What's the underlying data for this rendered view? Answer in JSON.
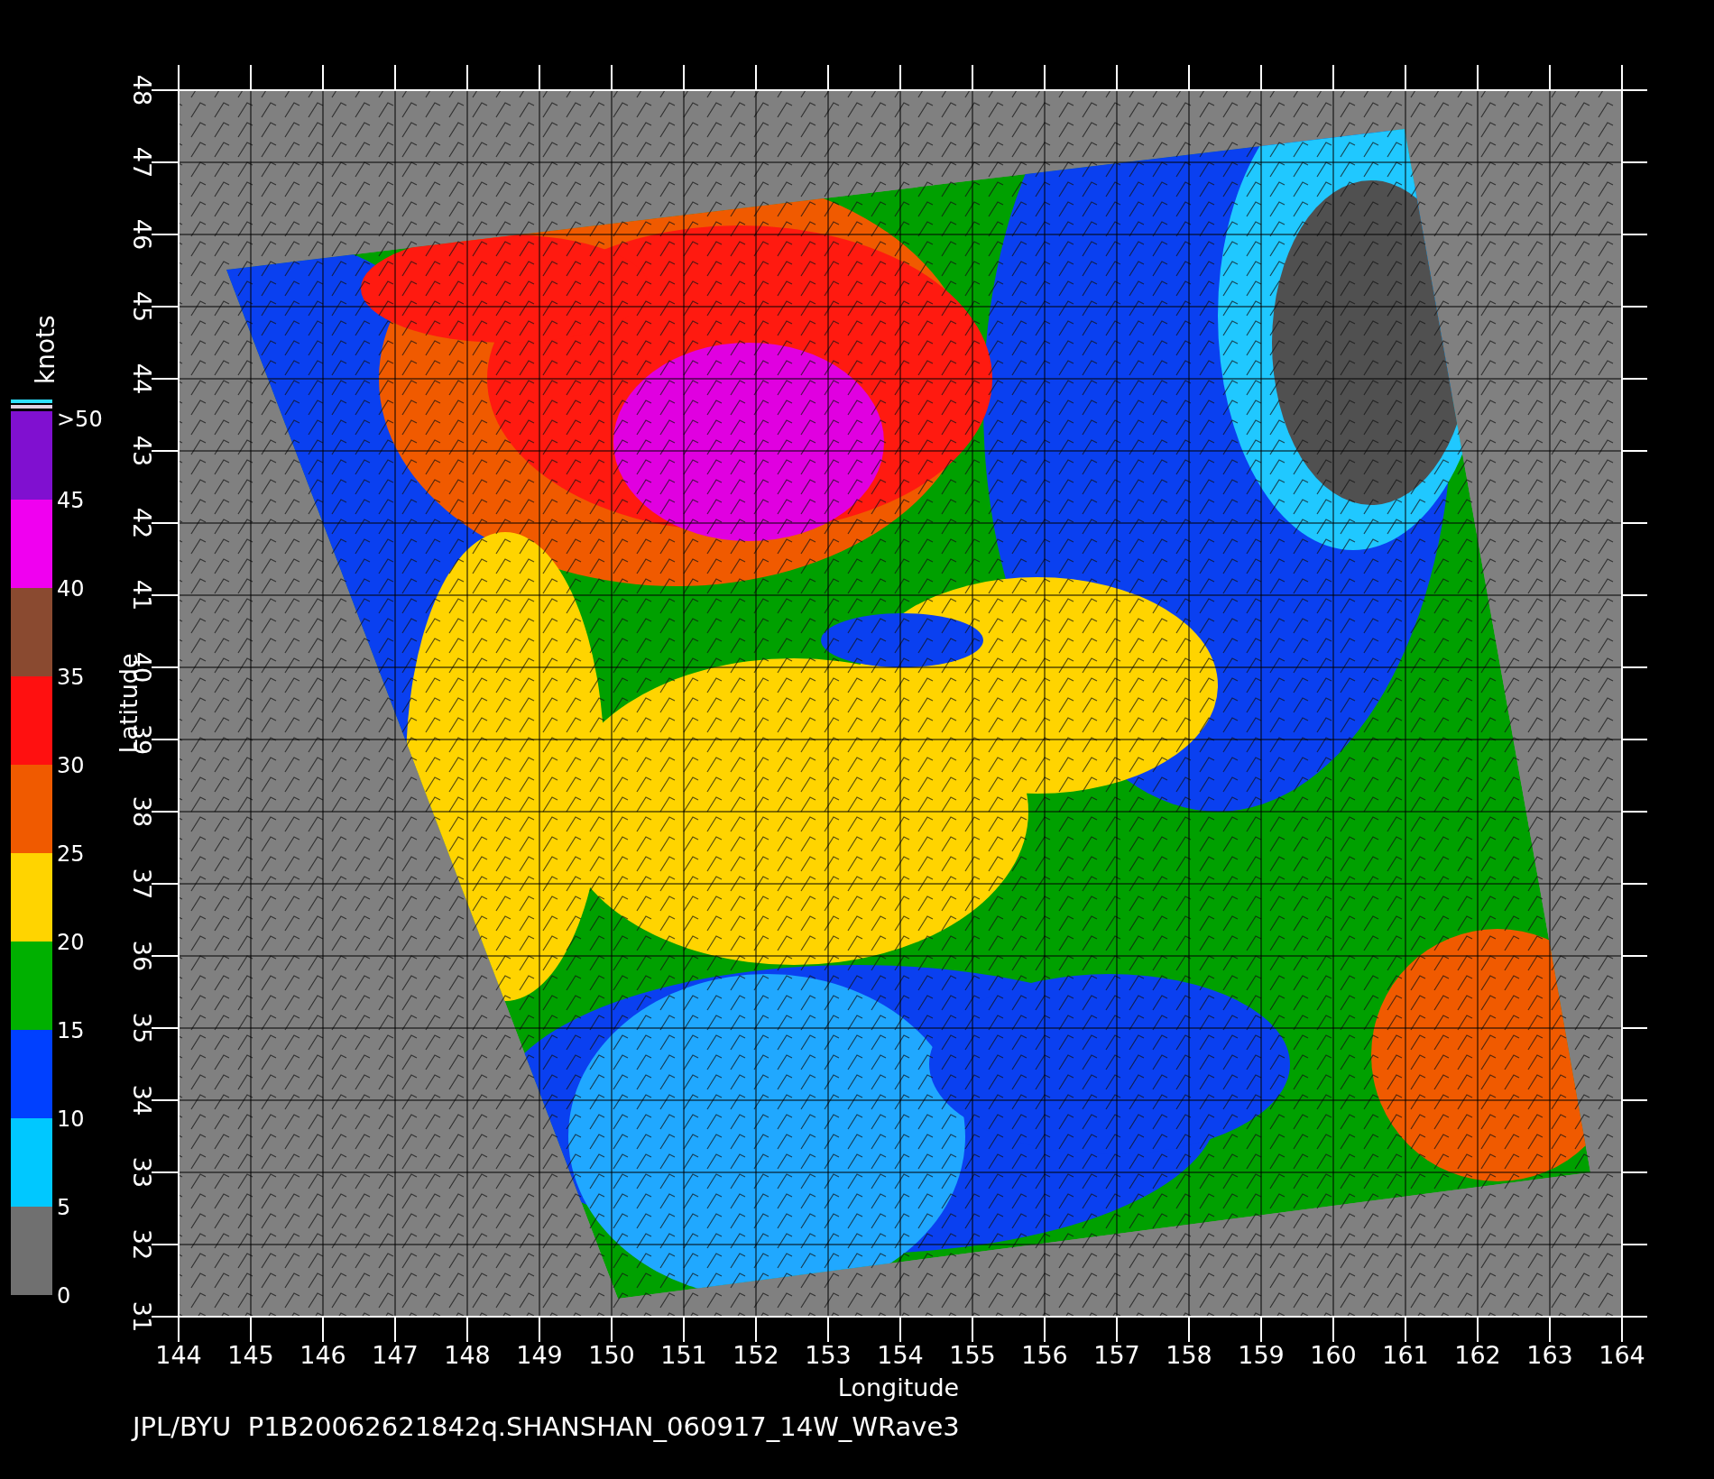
{
  "plot": {
    "x_axis": {
      "title": "Longitude",
      "ticks": [
        "144",
        "145",
        "146",
        "147",
        "148",
        "149",
        "150",
        "151",
        "152",
        "153",
        "154",
        "155",
        "156",
        "157",
        "158",
        "159",
        "160",
        "161",
        "162",
        "163",
        "164"
      ]
    },
    "y_axis": {
      "title": "Latitude",
      "ticks": [
        "48",
        "47",
        "46",
        "45",
        "44",
        "43",
        "42",
        "41",
        "40",
        "39",
        "38",
        "37",
        "36",
        "35",
        "34",
        "33",
        "32",
        "31"
      ]
    }
  },
  "colorbar": {
    "title": "knots",
    "labels": [
      ">50",
      "45",
      "40",
      "35",
      "30",
      "25",
      "20",
      "15",
      "10",
      "5",
      "0"
    ],
    "segments": [
      {
        "color": "#8010d0"
      },
      {
        "color": "#f000f0"
      },
      {
        "color": "#8a4a30"
      },
      {
        "color": "#ff1010"
      },
      {
        "color": "#f05a00"
      },
      {
        "color": "#ffd400"
      },
      {
        "color": "#00b000"
      },
      {
        "color": "#0040ff"
      },
      {
        "color": "#00c8ff"
      },
      {
        "color": "#707070"
      }
    ]
  },
  "caption": "JPL/BYU  P1B20062621842q.SHANSHAN_060917_14W_WRave3"
}
